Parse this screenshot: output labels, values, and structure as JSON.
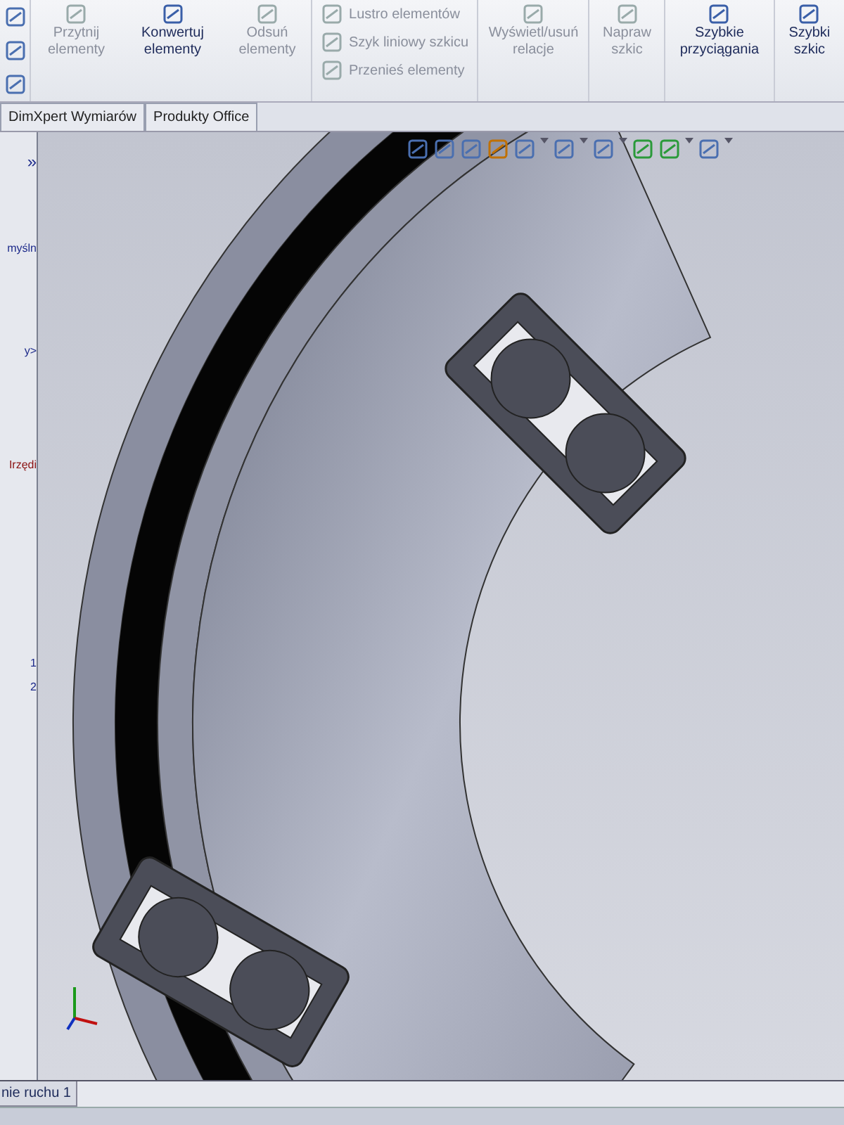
{
  "ribbon": {
    "groups": [
      {
        "kind": "large",
        "label": "Przytnij elementy",
        "disabled": true
      },
      {
        "kind": "large",
        "label": "Konwertuj elementy",
        "disabled": false
      },
      {
        "kind": "large",
        "label": "Odsuń elementy",
        "disabled": true
      },
      {
        "kind": "stack",
        "items": [
          {
            "label": "Lustro elementów",
            "disabled": true
          },
          {
            "label": "Szyk liniowy szkicu",
            "disabled": true
          },
          {
            "label": "Przenieś elementy",
            "disabled": true
          }
        ]
      },
      {
        "kind": "large",
        "label": "Wyświetl/usuń relacje",
        "disabled": true
      },
      {
        "kind": "large",
        "label": "Napraw szkic",
        "disabled": true
      },
      {
        "kind": "large",
        "label": "Szybkie przyciągania",
        "disabled": false
      },
      {
        "kind": "large",
        "label": "Szybki szkic",
        "disabled": false
      }
    ]
  },
  "tabs": [
    {
      "label": "DimXpert Wymiarów",
      "selected": false
    },
    {
      "label": "Produkty Office",
      "selected": false
    }
  ],
  "sidebar": {
    "expand": "»",
    "items": [
      "myśln",
      "y>",
      "Irzędi",
      "1",
      "2"
    ]
  },
  "bottom_tabs": [
    {
      "label": "nie ruchu 1",
      "selected": true
    }
  ]
}
